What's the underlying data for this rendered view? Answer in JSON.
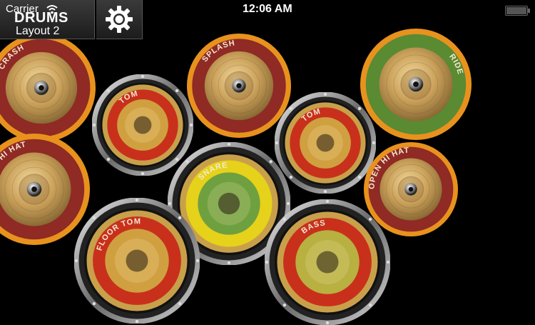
{
  "status_bar": {
    "carrier": "Carrier",
    "time": "12:06 AM"
  },
  "header": {
    "app_title": "DRUMS",
    "layout_name": "Layout 2"
  },
  "colors": {
    "background": "#000000",
    "cymbal_orange": "#e8921e",
    "cymbal_red": "#8f2a24",
    "cymbal_green": "#5a8a32",
    "drum_red": "#c8301c",
    "snare_yellow": "#e6d21a"
  },
  "pads": [
    {
      "kind": "cymbal",
      "label": "CRASH",
      "ring": "#8f2a24"
    },
    {
      "kind": "cymbal",
      "label": "SPLASH",
      "ring": "#8f2a24"
    },
    {
      "kind": "cymbal",
      "label": "RIDE",
      "ring": "#5a8a32"
    },
    {
      "kind": "drum",
      "label": "TOM",
      "ring": "#c8301c",
      "inner": "#d0a040"
    },
    {
      "kind": "drum",
      "label": "TOM",
      "ring": "#c8301c",
      "inner": "#d0a040"
    },
    {
      "kind": "cymbal",
      "label": "CLOSED HI HAT",
      "ring": "#8f2a24"
    },
    {
      "kind": "cymbal",
      "label": "OPEN HI HAT",
      "ring": "#8f2a24"
    },
    {
      "kind": "drum",
      "label": "SNARE",
      "ring": "#e6d21a",
      "inner": "#6fa040"
    },
    {
      "kind": "drum",
      "label": "FLOOR TOM",
      "ring": "#c8301c",
      "inner": "#d0a040"
    },
    {
      "kind": "drum",
      "label": "BASS",
      "ring": "#c8301c",
      "inner": "#b8b040"
    }
  ]
}
